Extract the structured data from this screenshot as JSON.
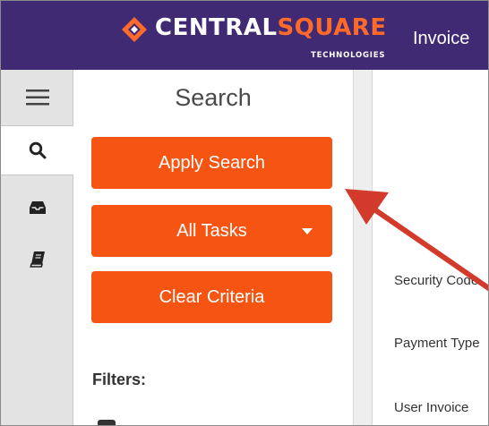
{
  "header": {
    "brand_primary": "CENTRAL",
    "brand_accent": "SQUARE",
    "brand_sub": "TECHNOLOGIES",
    "app_title": "Invoice"
  },
  "rail": {
    "items": [
      {
        "icon": "hamburger-menu-icon"
      },
      {
        "icon": "search-icon",
        "active": true
      },
      {
        "icon": "inbox-icon"
      },
      {
        "icon": "book-icon"
      }
    ]
  },
  "search_panel": {
    "title": "Search",
    "apply_label": "Apply Search",
    "tasks_label": "All Tasks",
    "clear_label": "Clear Criteria",
    "filters_label": "Filters:"
  },
  "content": {
    "labels": [
      "Security Code",
      "Payment Type",
      "User Invoice"
    ]
  },
  "colors": {
    "header_bg": "#3f2a73",
    "accent": "#f55412",
    "brand_orange": "#ff6a2b",
    "annotation_arrow": "#d23a2c",
    "rail_bg": "#e3e3e3"
  }
}
